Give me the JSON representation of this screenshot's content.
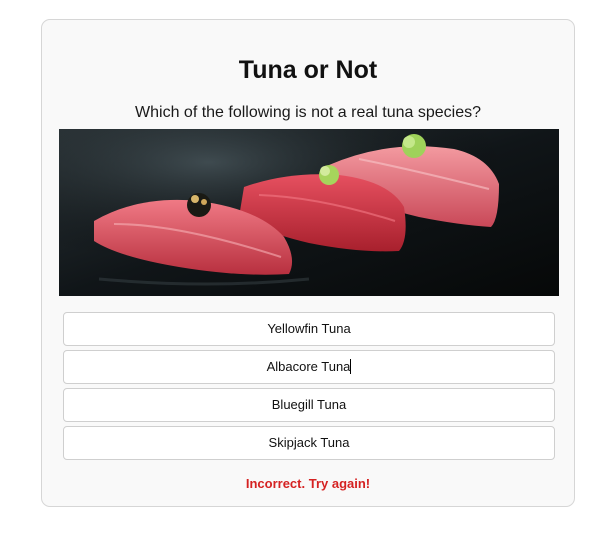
{
  "quiz": {
    "title": "Tuna or Not",
    "question": "Which of the following is not a real tuna species?",
    "image_subject": "tuna sushi nigiri photo",
    "options": [
      {
        "label": "Yellowfin Tuna"
      },
      {
        "label": "Albacore Tuna"
      },
      {
        "label": "Bluegill Tuna"
      },
      {
        "label": "Skipjack Tuna"
      }
    ],
    "feedback": "Incorrect. Try again!"
  },
  "colors": {
    "card_background": "#f9f9f9",
    "card_border": "#d6d6d6",
    "feedback_error": "#d52222",
    "option_background": "#ffffff"
  }
}
